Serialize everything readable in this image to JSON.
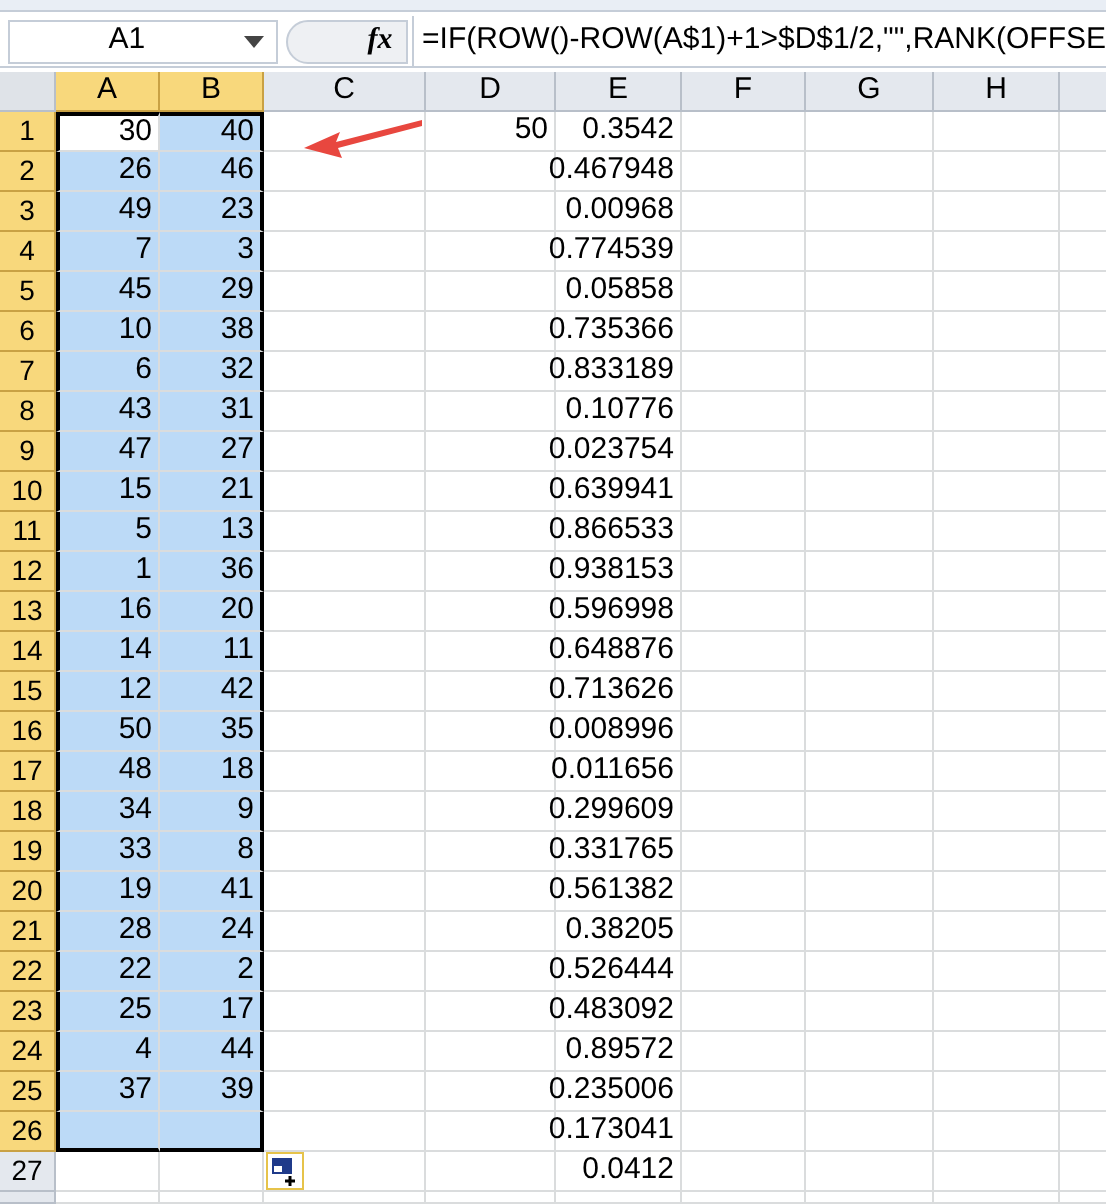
{
  "name_box": {
    "value": "A1"
  },
  "formula_bar": {
    "fx": "fx",
    "formula": "=IF(ROW()-ROW(A$1)+1>$D$1/2,\"\",RANK(OFFSE"
  },
  "columns": [
    {
      "label": "A",
      "selected": true
    },
    {
      "label": "B",
      "selected": true
    },
    {
      "label": "C",
      "selected": false
    },
    {
      "label": "D",
      "selected": false
    },
    {
      "label": "E",
      "selected": false
    },
    {
      "label": "F",
      "selected": false
    },
    {
      "label": "G",
      "selected": false
    },
    {
      "label": "H",
      "selected": false
    }
  ],
  "rows": [
    {
      "label": "1",
      "selected": true,
      "cells": [
        {
          "value": "30",
          "selected": true,
          "active": true
        },
        {
          "value": "40",
          "selected": true,
          "active": false
        },
        {
          "selected": false,
          "active": false
        },
        {
          "value": "50",
          "selected": false,
          "active": false
        },
        {
          "value": "0.3542",
          "selected": false,
          "active": false
        }
      ]
    },
    {
      "label": "2",
      "selected": true,
      "cells": [
        {
          "value": "26",
          "selected": true,
          "active": false
        },
        {
          "value": "46",
          "selected": true,
          "active": false
        },
        {
          "selected": false,
          "active": false
        },
        {
          "selected": false,
          "active": false
        },
        {
          "value": "0.467948",
          "selected": false,
          "active": false
        }
      ]
    },
    {
      "label": "3",
      "selected": true,
      "cells": [
        {
          "value": "49",
          "selected": true,
          "active": false
        },
        {
          "value": "23",
          "selected": true,
          "active": false
        },
        {
          "selected": false,
          "active": false
        },
        {
          "selected": false,
          "active": false
        },
        {
          "value": "0.00968",
          "selected": false,
          "active": false
        }
      ]
    },
    {
      "label": "4",
      "selected": true,
      "cells": [
        {
          "value": "7",
          "selected": true,
          "active": false
        },
        {
          "value": "3",
          "selected": true,
          "active": false
        },
        {
          "selected": false,
          "active": false
        },
        {
          "selected": false,
          "active": false
        },
        {
          "value": "0.774539",
          "selected": false,
          "active": false
        }
      ]
    },
    {
      "label": "5",
      "selected": true,
      "cells": [
        {
          "value": "45",
          "selected": true,
          "active": false
        },
        {
          "value": "29",
          "selected": true,
          "active": false
        },
        {
          "selected": false,
          "active": false
        },
        {
          "selected": false,
          "active": false
        },
        {
          "value": "0.05858",
          "selected": false,
          "active": false
        }
      ]
    },
    {
      "label": "6",
      "selected": true,
      "cells": [
        {
          "value": "10",
          "selected": true,
          "active": false
        },
        {
          "value": "38",
          "selected": true,
          "active": false
        },
        {
          "selected": false,
          "active": false
        },
        {
          "selected": false,
          "active": false
        },
        {
          "value": "0.735366",
          "selected": false,
          "active": false
        }
      ]
    },
    {
      "label": "7",
      "selected": true,
      "cells": [
        {
          "value": "6",
          "selected": true,
          "active": false
        },
        {
          "value": "32",
          "selected": true,
          "active": false
        },
        {
          "selected": false,
          "active": false
        },
        {
          "selected": false,
          "active": false
        },
        {
          "value": "0.833189",
          "selected": false,
          "active": false
        }
      ]
    },
    {
      "label": "8",
      "selected": true,
      "cells": [
        {
          "value": "43",
          "selected": true,
          "active": false
        },
        {
          "value": "31",
          "selected": true,
          "active": false
        },
        {
          "selected": false,
          "active": false
        },
        {
          "selected": false,
          "active": false
        },
        {
          "value": "0.10776",
          "selected": false,
          "active": false
        }
      ]
    },
    {
      "label": "9",
      "selected": true,
      "cells": [
        {
          "value": "47",
          "selected": true,
          "active": false
        },
        {
          "value": "27",
          "selected": true,
          "active": false
        },
        {
          "selected": false,
          "active": false
        },
        {
          "selected": false,
          "active": false
        },
        {
          "value": "0.023754",
          "selected": false,
          "active": false
        }
      ]
    },
    {
      "label": "10",
      "selected": true,
      "cells": [
        {
          "value": "15",
          "selected": true,
          "active": false
        },
        {
          "value": "21",
          "selected": true,
          "active": false
        },
        {
          "selected": false,
          "active": false
        },
        {
          "selected": false,
          "active": false
        },
        {
          "value": "0.639941",
          "selected": false,
          "active": false
        }
      ]
    },
    {
      "label": "11",
      "selected": true,
      "cells": [
        {
          "value": "5",
          "selected": true,
          "active": false
        },
        {
          "value": "13",
          "selected": true,
          "active": false
        },
        {
          "selected": false,
          "active": false
        },
        {
          "selected": false,
          "active": false
        },
        {
          "value": "0.866533",
          "selected": false,
          "active": false
        }
      ]
    },
    {
      "label": "12",
      "selected": true,
      "cells": [
        {
          "value": "1",
          "selected": true,
          "active": false
        },
        {
          "value": "36",
          "selected": true,
          "active": false
        },
        {
          "selected": false,
          "active": false
        },
        {
          "selected": false,
          "active": false
        },
        {
          "value": "0.938153",
          "selected": false,
          "active": false
        }
      ]
    },
    {
      "label": "13",
      "selected": true,
      "cells": [
        {
          "value": "16",
          "selected": true,
          "active": false
        },
        {
          "value": "20",
          "selected": true,
          "active": false
        },
        {
          "selected": false,
          "active": false
        },
        {
          "selected": false,
          "active": false
        },
        {
          "value": "0.596998",
          "selected": false,
          "active": false
        }
      ]
    },
    {
      "label": "14",
      "selected": true,
      "cells": [
        {
          "value": "14",
          "selected": true,
          "active": false
        },
        {
          "value": "11",
          "selected": true,
          "active": false
        },
        {
          "selected": false,
          "active": false
        },
        {
          "selected": false,
          "active": false
        },
        {
          "value": "0.648876",
          "selected": false,
          "active": false
        }
      ]
    },
    {
      "label": "15",
      "selected": true,
      "cells": [
        {
          "value": "12",
          "selected": true,
          "active": false
        },
        {
          "value": "42",
          "selected": true,
          "active": false
        },
        {
          "selected": false,
          "active": false
        },
        {
          "selected": false,
          "active": false
        },
        {
          "value": "0.713626",
          "selected": false,
          "active": false
        }
      ]
    },
    {
      "label": "16",
      "selected": true,
      "cells": [
        {
          "value": "50",
          "selected": true,
          "active": false
        },
        {
          "value": "35",
          "selected": true,
          "active": false
        },
        {
          "selected": false,
          "active": false
        },
        {
          "selected": false,
          "active": false
        },
        {
          "value": "0.008996",
          "selected": false,
          "active": false
        }
      ]
    },
    {
      "label": "17",
      "selected": true,
      "cells": [
        {
          "value": "48",
          "selected": true,
          "active": false
        },
        {
          "value": "18",
          "selected": true,
          "active": false
        },
        {
          "selected": false,
          "active": false
        },
        {
          "selected": false,
          "active": false
        },
        {
          "value": "0.011656",
          "selected": false,
          "active": false
        }
      ]
    },
    {
      "label": "18",
      "selected": true,
      "cells": [
        {
          "value": "34",
          "selected": true,
          "active": false
        },
        {
          "value": "9",
          "selected": true,
          "active": false
        },
        {
          "selected": false,
          "active": false
        },
        {
          "selected": false,
          "active": false
        },
        {
          "value": "0.299609",
          "selected": false,
          "active": false
        }
      ]
    },
    {
      "label": "19",
      "selected": true,
      "cells": [
        {
          "value": "33",
          "selected": true,
          "active": false
        },
        {
          "value": "8",
          "selected": true,
          "active": false
        },
        {
          "selected": false,
          "active": false
        },
        {
          "selected": false,
          "active": false
        },
        {
          "value": "0.331765",
          "selected": false,
          "active": false
        }
      ]
    },
    {
      "label": "20",
      "selected": true,
      "cells": [
        {
          "value": "19",
          "selected": true,
          "active": false
        },
        {
          "value": "41",
          "selected": true,
          "active": false
        },
        {
          "selected": false,
          "active": false
        },
        {
          "selected": false,
          "active": false
        },
        {
          "value": "0.561382",
          "selected": false,
          "active": false
        }
      ]
    },
    {
      "label": "21",
      "selected": true,
      "cells": [
        {
          "value": "28",
          "selected": true,
          "active": false
        },
        {
          "value": "24",
          "selected": true,
          "active": false
        },
        {
          "selected": false,
          "active": false
        },
        {
          "selected": false,
          "active": false
        },
        {
          "value": "0.38205",
          "selected": false,
          "active": false
        }
      ]
    },
    {
      "label": "22",
      "selected": true,
      "cells": [
        {
          "value": "22",
          "selected": true,
          "active": false
        },
        {
          "value": "2",
          "selected": true,
          "active": false
        },
        {
          "selected": false,
          "active": false
        },
        {
          "selected": false,
          "active": false
        },
        {
          "value": "0.526444",
          "selected": false,
          "active": false
        }
      ]
    },
    {
      "label": "23",
      "selected": true,
      "cells": [
        {
          "value": "25",
          "selected": true,
          "active": false
        },
        {
          "value": "17",
          "selected": true,
          "active": false
        },
        {
          "selected": false,
          "active": false
        },
        {
          "selected": false,
          "active": false
        },
        {
          "value": "0.483092",
          "selected": false,
          "active": false
        }
      ]
    },
    {
      "label": "24",
      "selected": true,
      "cells": [
        {
          "value": "4",
          "selected": true,
          "active": false
        },
        {
          "value": "44",
          "selected": true,
          "active": false
        },
        {
          "selected": false,
          "active": false
        },
        {
          "selected": false,
          "active": false
        },
        {
          "value": "0.89572",
          "selected": false,
          "active": false
        }
      ]
    },
    {
      "label": "25",
      "selected": true,
      "cells": [
        {
          "value": "37",
          "selected": true,
          "active": false
        },
        {
          "value": "39",
          "selected": true,
          "active": false
        },
        {
          "selected": false,
          "active": false
        },
        {
          "selected": false,
          "active": false
        },
        {
          "value": "0.235006",
          "selected": false,
          "active": false
        }
      ]
    },
    {
      "label": "26",
      "selected": true,
      "cells": [
        {
          "selected": true,
          "active": false
        },
        {
          "selected": true,
          "active": false
        },
        {
          "selected": false,
          "active": false
        },
        {
          "selected": false,
          "active": false
        },
        {
          "value": "0.173041",
          "selected": false,
          "active": false
        }
      ]
    },
    {
      "label": "27",
      "selected": false,
      "cells": [
        {
          "selected": false,
          "active": false
        },
        {
          "selected": false,
          "active": false
        },
        {
          "selected": false,
          "active": false
        },
        {
          "selected": false,
          "active": false
        },
        {
          "value": "0.0412",
          "selected": false,
          "active": false
        }
      ]
    }
  ]
}
